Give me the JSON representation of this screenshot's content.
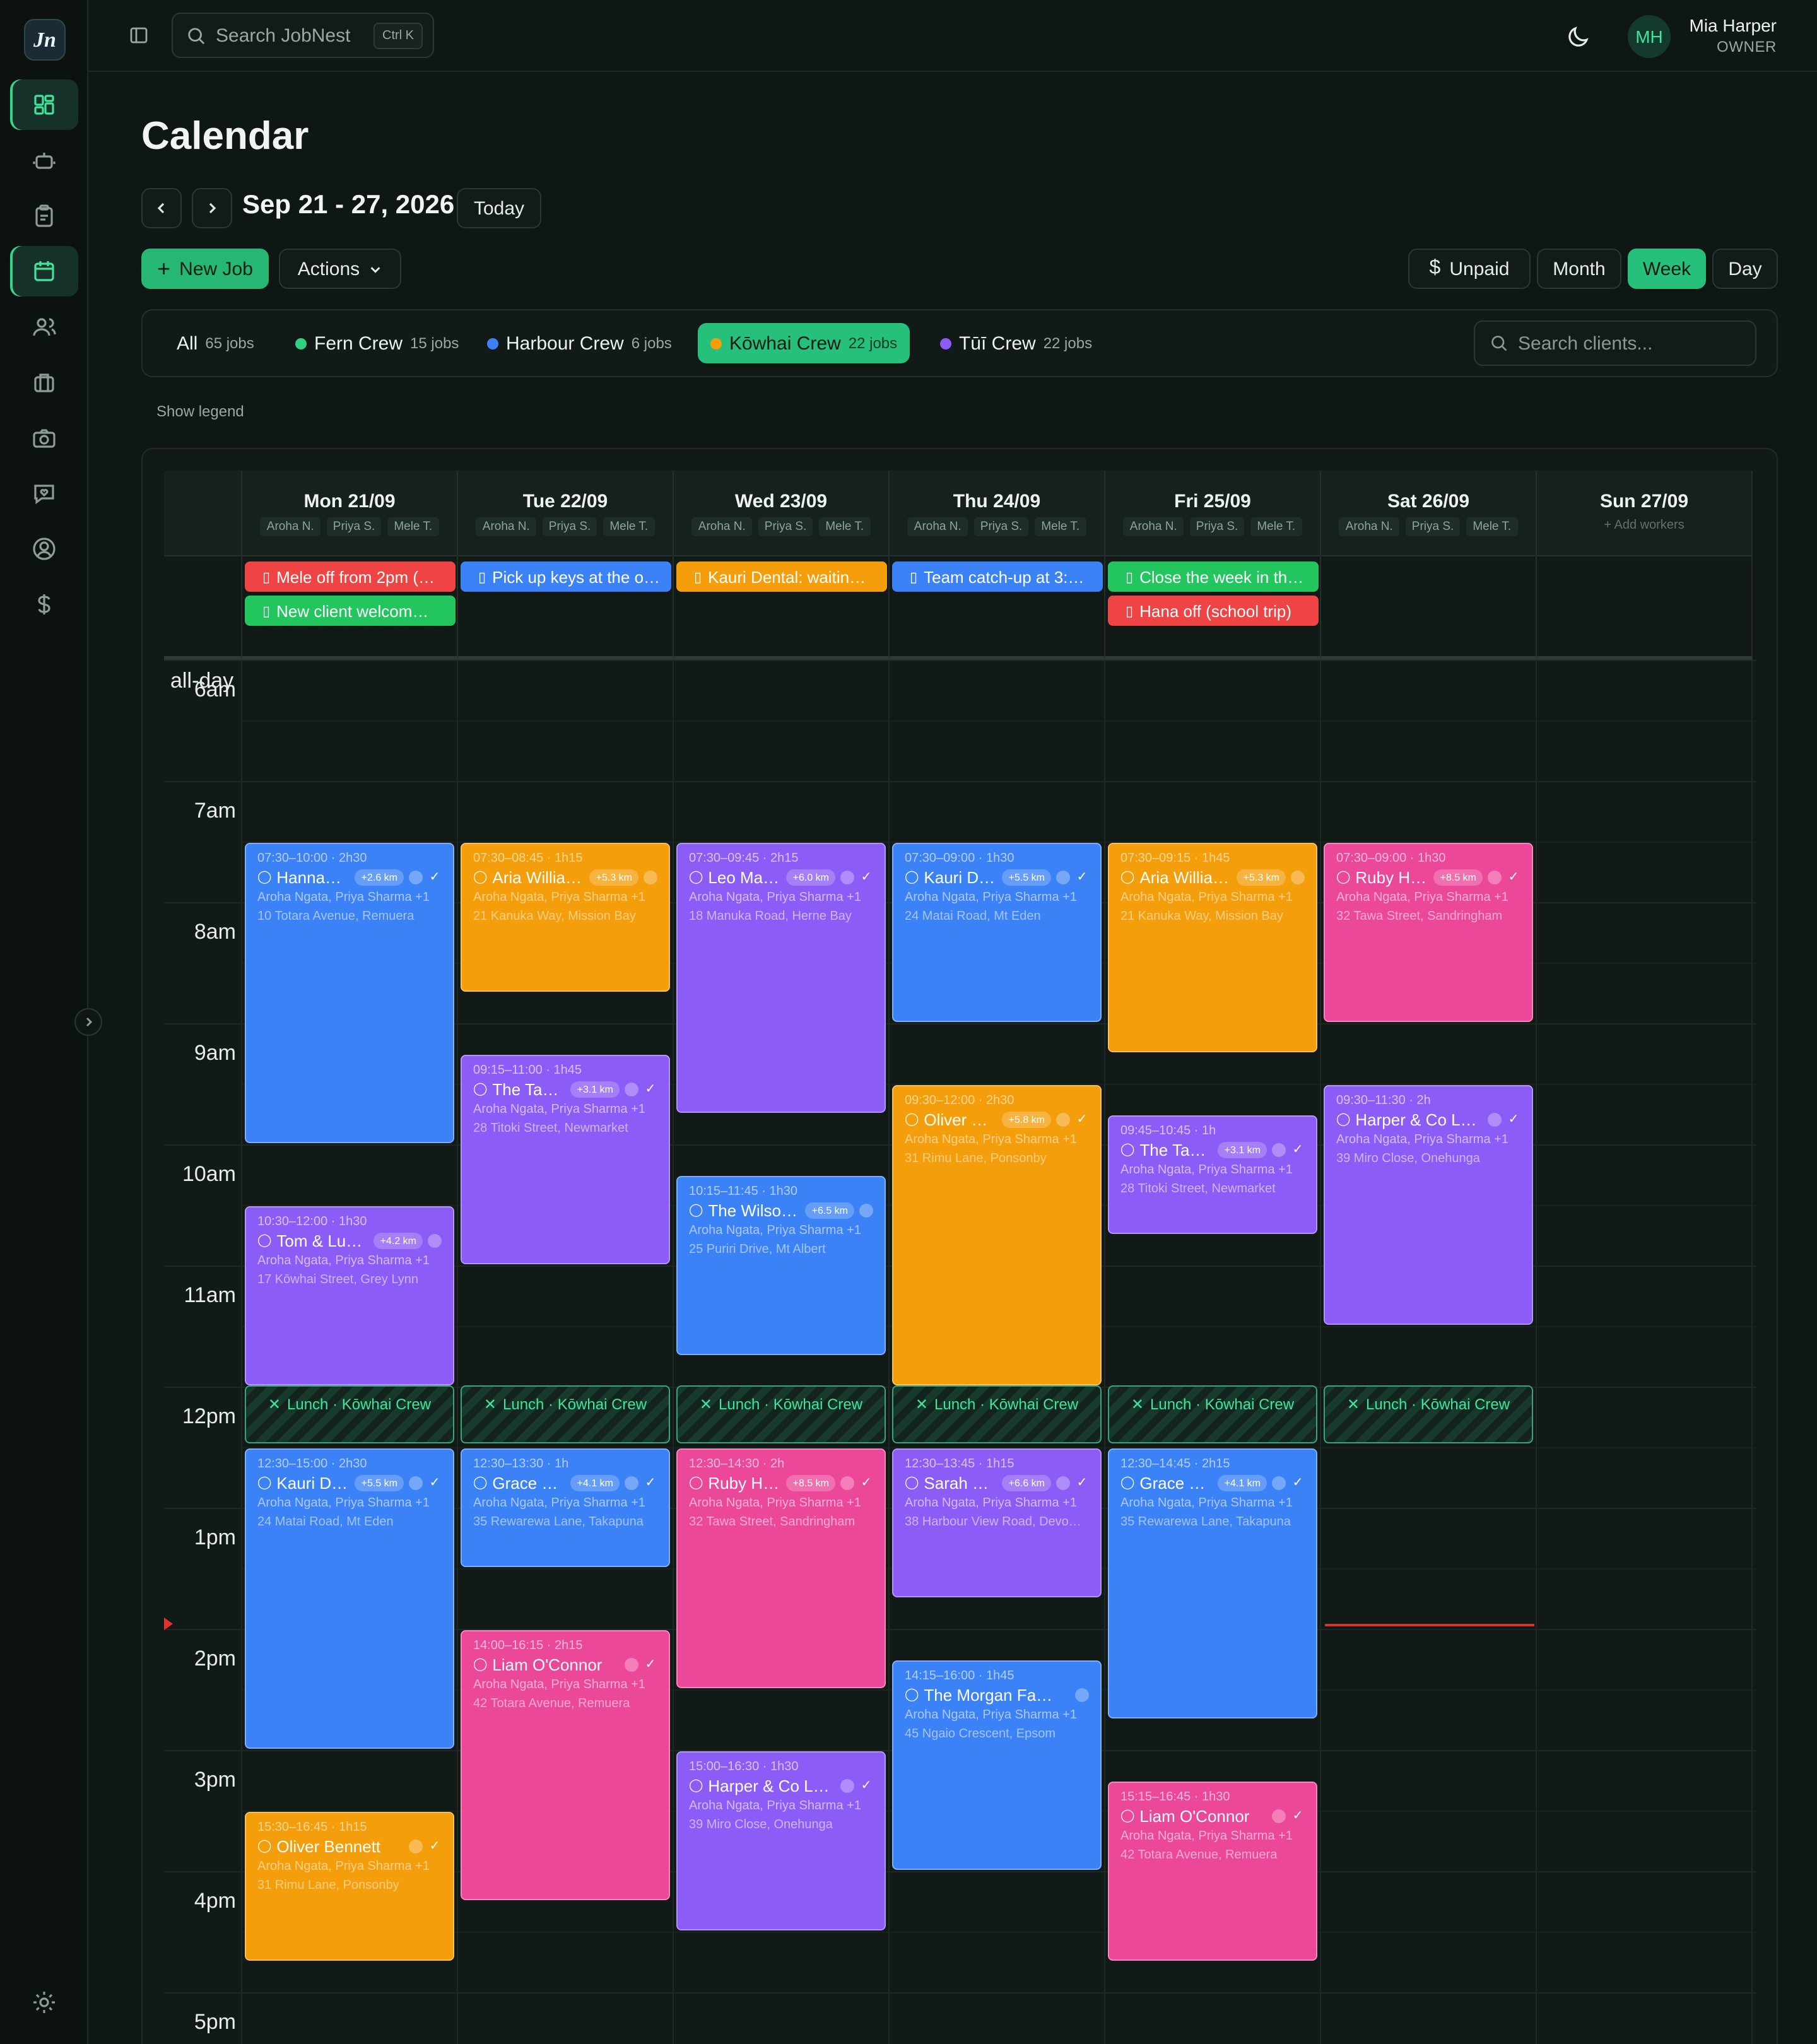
{
  "app": {
    "logo": "Jn"
  },
  "topbar": {
    "search_placeholder": "Search JobNest",
    "shortcut": "Ctrl K",
    "user": {
      "initials": "MH",
      "name": "Mia Harper",
      "role": "OWNER"
    }
  },
  "page": {
    "title": "Calendar",
    "range": "Sep 21 - 27, 2026",
    "today_label": "Today",
    "new_job_label": "New Job",
    "actions_label": "Actions",
    "unpaid_label": "Unpaid",
    "views": [
      "Month",
      "Week",
      "Day"
    ],
    "active_view": "Week",
    "show_legend": "Show legend"
  },
  "crews": [
    {
      "name": "All",
      "count": "65 jobs",
      "color": ""
    },
    {
      "name": "Fern Crew",
      "count": "15 jobs",
      "color": "#2fd07e"
    },
    {
      "name": "Harbour Crew",
      "count": "6 jobs",
      "color": "#3b82f6"
    },
    {
      "name": "Kōwhai Crew",
      "count": "22 jobs",
      "color": "#f59e0b",
      "selected": true
    },
    {
      "name": "Tūī Crew",
      "count": "22 jobs",
      "color": "#8b5cf6"
    }
  ],
  "client_search_placeholder": "Search clients...",
  "colors": {
    "accent": "#27c07a",
    "blue": "#3b82f6",
    "orange": "#f59e0b",
    "purple": "#8b5cf6",
    "pink": "#ec4899",
    "red": "#ef4444",
    "green": "#22c55e"
  },
  "days": [
    {
      "label": "Mon 21/09",
      "workers": [
        "Aroha N.",
        "Priya S.",
        "Mele T."
      ]
    },
    {
      "label": "Tue 22/09",
      "workers": [
        "Aroha N.",
        "Priya S.",
        "Mele T."
      ]
    },
    {
      "label": "Wed 23/09",
      "workers": [
        "Aroha N.",
        "Priya S.",
        "Mele T."
      ]
    },
    {
      "label": "Thu 24/09",
      "workers": [
        "Aroha N.",
        "Priya S.",
        "Mele T."
      ]
    },
    {
      "label": "Fri 25/09",
      "workers": [
        "Aroha N.",
        "Priya S.",
        "Mele T."
      ]
    },
    {
      "label": "Sat 26/09",
      "workers": [
        "Aroha N.",
        "Priya S.",
        "Mele T."
      ]
    },
    {
      "label": "Sun 27/09",
      "workers": [],
      "add_workers": "+ Add workers"
    }
  ],
  "allday_label": "all-day",
  "allday_events": [
    {
      "day": 0,
      "row": 0,
      "title": "Mele off from 2pm (…",
      "color": "red"
    },
    {
      "day": 0,
      "row": 1,
      "title": "New client welcom…",
      "color": "green"
    },
    {
      "day": 1,
      "row": 0,
      "title": "Pick up keys at the o…",
      "color": "blue"
    },
    {
      "day": 2,
      "row": 0,
      "title": "Kauri Dental: waitin…",
      "color": "orange"
    },
    {
      "day": 3,
      "row": 0,
      "title": "Team catch-up at 3:…",
      "color": "blue"
    },
    {
      "day": 4,
      "row": 0,
      "title": "Close the week in th…",
      "color": "green"
    },
    {
      "day": 4,
      "row": 1,
      "title": "Hana off (school trip)",
      "color": "red"
    }
  ],
  "hours": [
    "6am",
    "7am",
    "8am",
    "9am",
    "10am",
    "11am",
    "12pm",
    "1pm",
    "2pm",
    "3pm",
    "4pm",
    "5pm"
  ],
  "lunch_label": "Lunch · Kōwhai Crew",
  "lunch_days": [
    0,
    1,
    2,
    3,
    4,
    5
  ],
  "workers_text": "Aroha Ngata, Priya Sharma +1",
  "events": [
    {
      "day": 0,
      "start": 7.5,
      "end": 10,
      "time": "07:30–10:00 · 2h30",
      "title": "Hanna…",
      "dist": "+2.6 km",
      "color": "blue",
      "check": true,
      "address": "10 Totara Avenue, Remuera"
    },
    {
      "day": 0,
      "start": 10.5,
      "end": 12,
      "time": "10:30–12:00 · 1h30",
      "title": "Tom & Luc…",
      "dist": "+4.2 km",
      "color": "purple",
      "check": false,
      "address": "17 Kōwhai Street, Grey Lynn"
    },
    {
      "day": 0,
      "start": 12.5,
      "end": 15,
      "time": "12:30–15:00 · 2h30",
      "title": "Kauri D…",
      "dist": "+5.5 km",
      "color": "blue",
      "check": true,
      "address": "24 Matai Road, Mt Eden"
    },
    {
      "day": 0,
      "start": 15.5,
      "end": 16.75,
      "time": "15:30–16:45 · 1h15",
      "title": "Oliver Bennett",
      "dist": "",
      "color": "orange",
      "check": true,
      "address": "31 Rimu Lane, Ponsonby"
    },
    {
      "day": 1,
      "start": 7.5,
      "end": 8.75,
      "time": "07:30–08:45 · 1h15",
      "title": "Aria Willia…",
      "dist": "+5.3 km",
      "color": "orange",
      "check": false,
      "address": "21 Kanuka Way, Mission Bay"
    },
    {
      "day": 1,
      "start": 9.25,
      "end": 11,
      "time": "09:15–11:00 · 1h45",
      "title": "The Tan…",
      "dist": "+3.1 km",
      "color": "purple",
      "check": true,
      "address": "28 Titoki Street, Newmarket"
    },
    {
      "day": 1,
      "start": 12.5,
      "end": 13.5,
      "time": "12:30–13:30 · 1h",
      "title": "Grace …",
      "dist": "+4.1 km",
      "color": "blue",
      "check": true,
      "address": "35 Rewarewa Lane, Takapuna"
    },
    {
      "day": 1,
      "start": 14,
      "end": 16.25,
      "time": "14:00–16:15 · 2h15",
      "title": "Liam O'Connor",
      "dist": "",
      "color": "pink",
      "check": true,
      "address": "42 Totara Avenue, Remuera"
    },
    {
      "day": 2,
      "start": 7.5,
      "end": 9.75,
      "time": "07:30–09:45 · 2h15",
      "title": "Leo Ma…",
      "dist": "+6.0 km",
      "color": "purple",
      "check": true,
      "address": "18 Manuka Road, Herne Bay"
    },
    {
      "day": 2,
      "start": 10.25,
      "end": 11.75,
      "time": "10:15–11:45 · 1h30",
      "title": "The Wilso…",
      "dist": "+6.5 km",
      "color": "blue",
      "check": false,
      "address": "25 Puriri Drive, Mt Albert"
    },
    {
      "day": 2,
      "start": 12.5,
      "end": 14.5,
      "time": "12:30–14:30 · 2h",
      "title": "Ruby H…",
      "dist": "+8.5 km",
      "color": "pink",
      "check": true,
      "address": "32 Tawa Street, Sandringham"
    },
    {
      "day": 2,
      "start": 15,
      "end": 16.5,
      "time": "15:00–16:30 · 1h30",
      "title": "Harper & Co La…",
      "dist": "",
      "color": "purple",
      "check": true,
      "address": "39 Miro Close, Onehunga"
    },
    {
      "day": 3,
      "start": 7.5,
      "end": 9,
      "time": "07:30–09:00 · 1h30",
      "title": "Kauri D…",
      "dist": "+5.5 km",
      "color": "blue",
      "check": true,
      "address": "24 Matai Road, Mt Eden"
    },
    {
      "day": 3,
      "start": 9.5,
      "end": 12,
      "time": "09:30–12:00 · 2h30",
      "title": "Oliver …",
      "dist": "+5.8 km",
      "color": "orange",
      "check": true,
      "address": "31 Rimu Lane, Ponsonby"
    },
    {
      "day": 3,
      "start": 12.5,
      "end": 13.75,
      "time": "12:30–13:45 · 1h15",
      "title": "Sarah …",
      "dist": "+6.6 km",
      "color": "purple",
      "check": true,
      "address": "38 Harbour View Road, Devo…"
    },
    {
      "day": 3,
      "start": 14.25,
      "end": 16,
      "time": "14:15–16:00 · 1h45",
      "title": "The Morgan Family",
      "dist": "",
      "color": "blue",
      "check": false,
      "address": "45 Ngaio Crescent, Epsom"
    },
    {
      "day": 4,
      "start": 7.5,
      "end": 9.25,
      "time": "07:30–09:15 · 1h45",
      "title": "Aria Willia…",
      "dist": "+5.3 km",
      "color": "orange",
      "check": false,
      "address": "21 Kanuka Way, Mission Bay"
    },
    {
      "day": 4,
      "start": 9.75,
      "end": 10.75,
      "time": "09:45–10:45 · 1h",
      "title": "The Tan…",
      "dist": "+3.1 km",
      "color": "purple",
      "check": true,
      "address": "28 Titoki Street, Newmarket"
    },
    {
      "day": 4,
      "start": 12.5,
      "end": 14.75,
      "time": "12:30–14:45 · 2h15",
      "title": "Grace …",
      "dist": "+4.1 km",
      "color": "blue",
      "check": true,
      "address": "35 Rewarewa Lane, Takapuna"
    },
    {
      "day": 4,
      "start": 15.25,
      "end": 16.75,
      "time": "15:15–16:45 · 1h30",
      "title": "Liam O'Connor",
      "dist": "",
      "color": "pink",
      "check": true,
      "address": "42 Totara Avenue, Remuera"
    },
    {
      "day": 5,
      "start": 7.5,
      "end": 9,
      "time": "07:30–09:00 · 1h30",
      "title": "Ruby H…",
      "dist": "+8.5 km",
      "color": "pink",
      "check": true,
      "address": "32 Tawa Street, Sandringham"
    },
    {
      "day": 5,
      "start": 9.5,
      "end": 11.5,
      "time": "09:30–11:30 · 2h",
      "title": "Harper & Co La…",
      "dist": "",
      "color": "purple",
      "check": true,
      "address": "39 Miro Close, Onehunga"
    }
  ]
}
